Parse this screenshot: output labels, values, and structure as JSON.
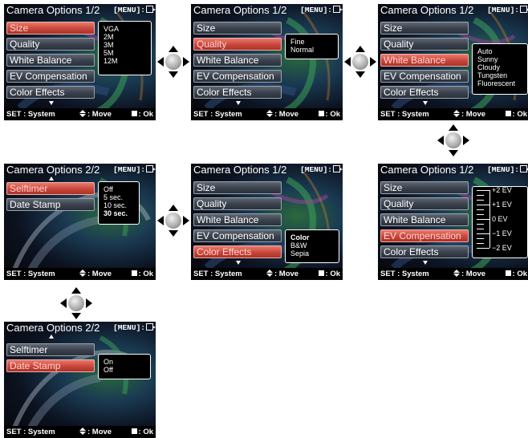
{
  "panels": [
    {
      "title": "Camera Options 1/2",
      "menu_label": "[MENU]:",
      "items": [
        "Size",
        "Quality",
        "White Balance",
        "EV Compensation",
        "Color Effects"
      ],
      "selected": 0,
      "popup": [
        "VGA",
        "2M",
        "3M",
        "5M",
        "12M"
      ]
    },
    {
      "title": "Camera Options 1/2",
      "menu_label": "[MENU]:",
      "items": [
        "Size",
        "Quality",
        "White Balance",
        "EV Compensation",
        "Color Effects"
      ],
      "selected": 1,
      "popup": [
        "Fine",
        "Normal"
      ]
    },
    {
      "title": "Camera Options 1/2",
      "menu_label": "[MENU]:",
      "items": [
        "Size",
        "Quality",
        "White Balance",
        "EV Compensation",
        "Color Effects"
      ],
      "selected": 2,
      "popup": [
        "Auto",
        "Sunny",
        "Cloudy",
        "Tungsten",
        "Fluorescent"
      ]
    },
    {
      "title": "Camera Options 2/2",
      "menu_label": "[MENU]:",
      "items": [
        "Selftimer",
        "Date Stamp"
      ],
      "selected": 0,
      "popup": [
        "Off",
        "5  sec.",
        "10 sec.",
        "30 sec."
      ]
    },
    {
      "title": "Camera Options 1/2",
      "menu_label": "[MENU]:",
      "items": [
        "Size",
        "Quality",
        "White Balance",
        "EV Compensation",
        "Color Effects"
      ],
      "selected": 4,
      "popup": [
        "Color",
        "B&W",
        "Sepia"
      ]
    },
    {
      "title": "Camera Options 1/2",
      "menu_label": "[MENU]:",
      "items": [
        "Size",
        "Quality",
        "White Balance",
        "EV Compensation",
        "Color Effects"
      ],
      "selected": 3,
      "popup": [
        "+2 EV",
        "+1 EV",
        "0  EV",
        "−1 EV",
        "−2 EV"
      ]
    },
    {
      "title": "Camera Options 2/2",
      "menu_label": "[MENU]:",
      "items": [
        "Selftimer",
        "Date Stamp"
      ],
      "selected": 1,
      "popup": [
        "On",
        "Off"
      ]
    }
  ],
  "footer": {
    "set": "SET : System",
    "move": ": Move",
    "ok": ": Ok"
  },
  "icons": {
    "exit": "exit-arrow-icon",
    "navigation": "dpad-icon",
    "updown": "updown-arrows-icon",
    "ok": "square-ok-icon"
  },
  "colors": {
    "selected_item": "#c9463a",
    "normal_item": "#3a414c",
    "popup_bg": "#000000",
    "footer_bg": "#000000"
  }
}
